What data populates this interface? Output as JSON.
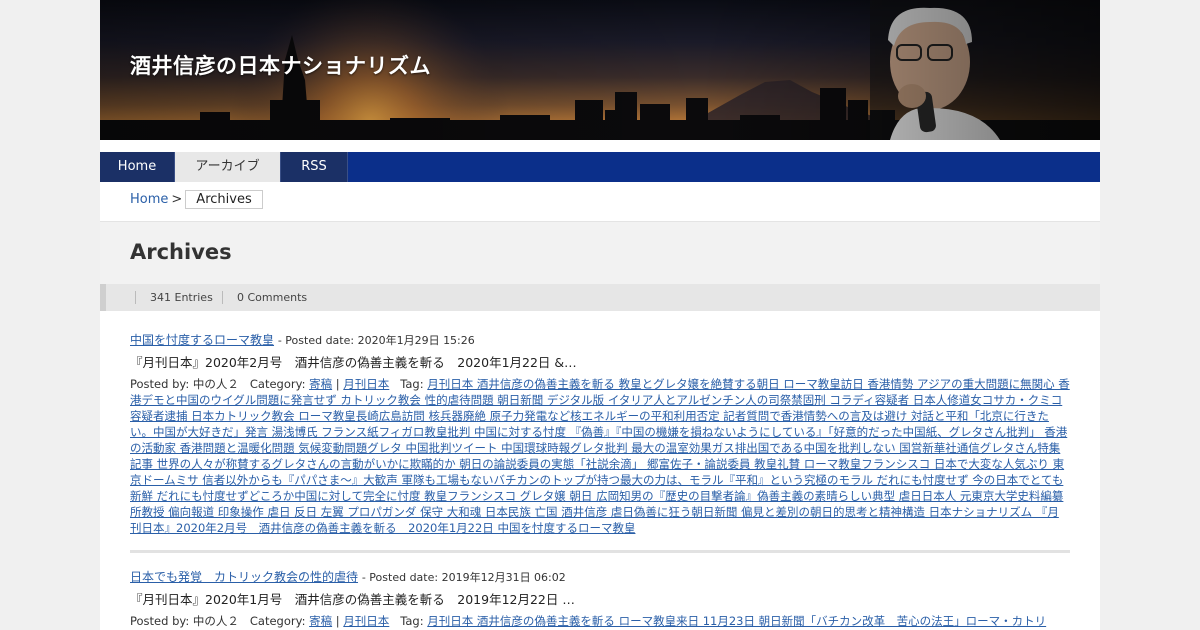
{
  "site": {
    "title": "酒井信彦の日本ナショナリズム"
  },
  "nav": {
    "items": [
      {
        "label": "Home"
      },
      {
        "label": "アーカイブ"
      },
      {
        "label": "RSS"
      }
    ]
  },
  "breadcrumb": {
    "home": "Home",
    "sep": ">",
    "current": "Archives"
  },
  "archives": {
    "title": "Archives",
    "entries_count": "341 Entries",
    "comments_count": "0 Comments"
  },
  "entries": [
    {
      "title": "中国を忖度するローマ教皇",
      "posted": "- Posted date: 2020年1月29日 15:26",
      "excerpt": "『月刊日本』2020年2月号　酒井信彦の偽善主義を斬る　2020年1月22日 &…",
      "posted_by_label": "Posted by:",
      "author": "中の人２",
      "category_label": "Category:",
      "categories": [
        "寄稿",
        "月刊日本"
      ],
      "tag_label": "Tag:",
      "tags": "月刊日本 酒井信彦の偽善主義を斬る 教皇とグレタ嬢を絶賛する朝日 ローマ教皇訪日 香港情勢 アジアの重大問題に無関心 香港デモと中国のウイグル問題に発言せず カトリック教会 性的虐待問題 朝日新聞 デジタル版 イタリア人とアルゼンチン人の司祭禁固刑 コラディ容疑者 日本人修道女コサカ・クミコ容疑者逮捕 日本カトリック教会 ローマ教皇長崎広島訪問 核兵器廃絶 原子力発電など核エネルギーの平和利用否定 記者質問で香港情勢への言及は避け 対話と平和「北京に行きたい。中国が大好きだ」発言 湯浅博氏 フランス紙フィガロ教皇批判 中国に対する忖度 『偽善』『中国の機嫌を損ねないようにしている』「好意的だった中国紙、グレタさん批判」 香港の活動家 香港問題と温暖化問題 気候変動問題グレタ 中国批判ツイート 中国環球時報グレタ批判 最大の温室効果ガス排出国である中国を批判しない 国営新華社通信グレタさん特集記事 世界の人々が称賛するグレタさんの言動がいかに欺瞞的か 朝日の論説委員の実態「社説余滴」 郷富佐子・論説委員 教皇礼賛 ローマ教皇フランシスコ 日本で大変な人気ぶり 東京ドームミサ 信者以外からも『パパさま～』大歓声 軍隊も工場もないバチカンのトップが持つ最大の力は、モラル『平和』という究極のモラル だれにも忖度せず 今の日本でとても新鮮 だれにも忖度せずどころか中国に対して完全に忖度 教皇フランシスコ グレタ嬢 朝日 広岡知男の『歴史の目撃者論』偽善主義の素晴らしい典型 虐日日本人 元東京大学史料編纂所教授 偏向報道 印象操作 虐日 反日 左翼 プロパガンダ 保守 大和魂 日本民族 亡国 酒井信彦 虐日偽善に狂う朝日新聞 偏見と差別の朝日的思考と精神構造 日本ナショナリズム 『月刊日本』2020年2月号　酒井信彦の偽善主義を斬る　2020年1月22日 中国を忖度するローマ教皇"
    },
    {
      "title": "日本でも発覚　カトリック教会の性的虐待",
      "posted": "- Posted date: 2019年12月31日 06:02",
      "excerpt": "『月刊日本』2020年1月号　酒井信彦の偽善主義を斬る　2019年12月22日 …",
      "posted_by_label": "Posted by:",
      "author": "中の人２",
      "category_label": "Category:",
      "categories": [
        "寄稿",
        "月刊日本"
      ],
      "tag_label": "Tag:",
      "tags": "月刊日本 酒井信彦の偽善主義を斬る ローマ教皇来日 11月23日 朝日新聞「バチカン改革　苦心の法王」ローマ・カトリ"
    }
  ]
}
